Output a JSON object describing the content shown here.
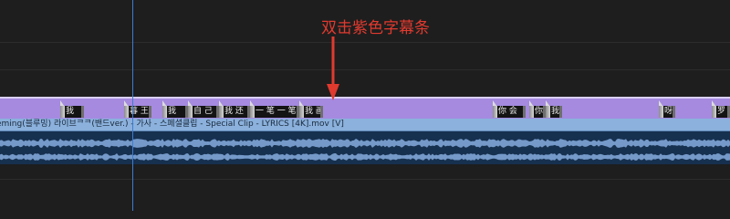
{
  "annotation": {
    "text": "双击紫色字幕条",
    "color": "#e03a2f"
  },
  "subtitle_track": {
    "color": "#a58ae0",
    "captions": [
      "我",
      "暮 王",
      "我",
      "自 己",
      "我 还",
      "一 笔 一 笔",
      "我 画",
      "你 会",
      "你",
      "我",
      "呀",
      "罗"
    ]
  },
  "video_clip": {
    "label": "eming(블루밍) 라이브ᄏᄏ(밴드ver.) - 가사 - 스페셜클립 - Special Clip - LYRICS [4K].mov [V]",
    "color": "#8bb1dc"
  },
  "playhead": {
    "color": "#3f7ccf"
  },
  "audio": {
    "color": "#16304f"
  }
}
